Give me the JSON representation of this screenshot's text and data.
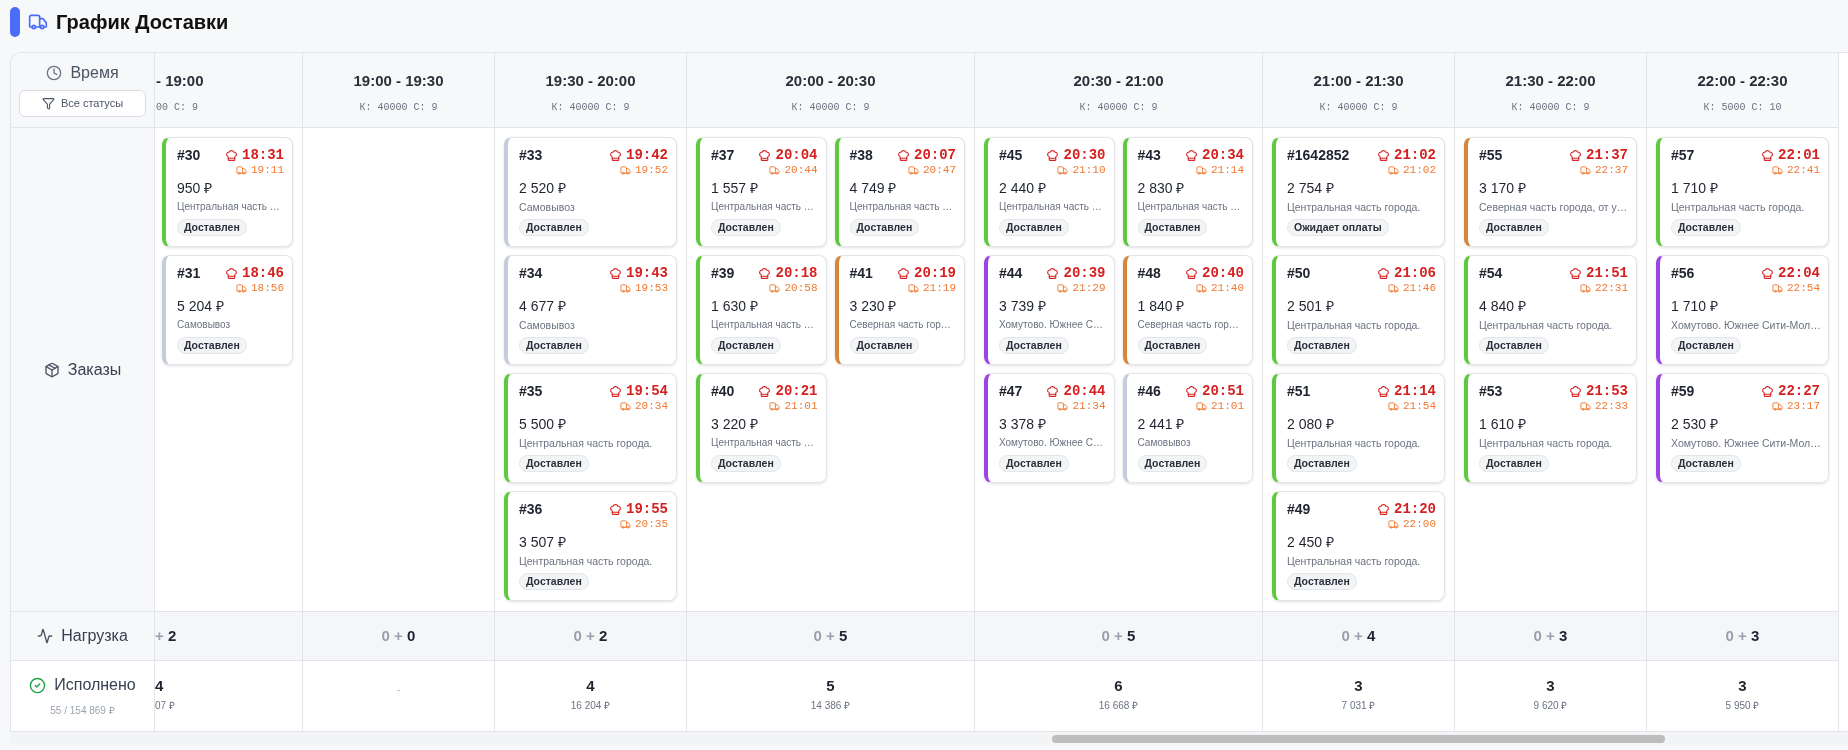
{
  "header": {
    "title": "График Доставки"
  },
  "sidebar": {
    "time_label": "Время",
    "filter_button": "Все статусы",
    "orders_label": "Заказы",
    "load_label": "Нагрузка",
    "done_label": "Исполнено",
    "done_summary": "55 / 154 869 ₽"
  },
  "slots": [
    {
      "time": "- 19:00",
      "capacity": "00 С: 9",
      "clipped": true,
      "load": "+ **2**",
      "done_count": "4",
      "done_sum": "07 ₽",
      "lanes": [
        [
          {
            "number": "#30",
            "ready": "18:31",
            "delivery": "19:11",
            "price": "950 ₽",
            "address": "Центральная часть …",
            "status": "Доставлен",
            "color": "#5ec83e"
          },
          {
            "number": "#31",
            "ready": "18:46",
            "delivery": "18:56",
            "price": "5 204 ₽",
            "address": "Самовывоз",
            "status": "Доставлен",
            "color": "#c5cddd"
          }
        ]
      ]
    },
    {
      "time": "19:00 - 19:30",
      "capacity": "К: 40000 С: 9",
      "clipped": false,
      "load": "0 + **0**",
      "done_count": "-"
    },
    {
      "time": "19:30 - 20:00",
      "capacity": "К: 40000 С: 9",
      "clipped": false,
      "load": "0 + **2**",
      "done_count": "4",
      "done_sum": "16 204 ₽",
      "lanes": [
        [
          {
            "number": "#33",
            "ready": "19:42",
            "delivery": "19:52",
            "price": "2 520 ₽",
            "address": "Самовывоз",
            "status": "Доставлен",
            "color": "#c5cddd"
          },
          {
            "number": "#34",
            "ready": "19:43",
            "delivery": "19:53",
            "price": "4 677 ₽",
            "address": "Самовывоз",
            "status": "Доставлен",
            "color": "#c5cddd"
          },
          {
            "number": "#35",
            "ready": "19:54",
            "delivery": "20:34",
            "price": "5 500 ₽",
            "address": "Центральная часть города.",
            "status": "Доставлен",
            "color": "#5ec83e"
          },
          {
            "number": "#36",
            "ready": "19:55",
            "delivery": "20:35",
            "price": "3 507 ₽",
            "address": "Центральная часть города.",
            "status": "Доставлен",
            "color": "#5ec83e"
          }
        ]
      ]
    },
    {
      "time": "20:00 - 20:30",
      "capacity": "К: 40000 С: 9",
      "clipped": false,
      "load": "0 + **5**",
      "done_count": "5",
      "done_sum": "14 386 ₽",
      "lanes": [
        [
          {
            "number": "#37",
            "ready": "20:04",
            "delivery": "20:44",
            "price": "1 557 ₽",
            "address": "Центральная часть …",
            "status": "Доставлен",
            "color": "#5ec83e"
          },
          {
            "number": "#39",
            "ready": "20:18",
            "delivery": "20:58",
            "price": "1 630 ₽",
            "address": "Центральная часть …",
            "status": "Доставлен",
            "color": "#5ec83e"
          },
          {
            "number": "#40",
            "ready": "20:21",
            "delivery": "21:01",
            "price": "3 220 ₽",
            "address": "Центральная часть …",
            "status": "Доставлен",
            "color": "#5ec83e"
          }
        ],
        [
          {
            "number": "#38",
            "ready": "20:07",
            "delivery": "20:47",
            "price": "4 749 ₽",
            "address": "Центральная часть …",
            "status": "Доставлен",
            "color": "#5ec83e"
          },
          {
            "number": "#41",
            "ready": "20:19",
            "delivery": "21:19",
            "price": "3 230 ₽",
            "address": "Северная часть гор…",
            "status": "Доставлен",
            "color": "#d6853c"
          }
        ]
      ]
    },
    {
      "time": "20:30 - 21:00",
      "capacity": "К: 40000 С: 9",
      "clipped": false,
      "load": "0 + **5**",
      "done_count": "6",
      "done_sum": "16 668 ₽",
      "lanes": [
        [
          {
            "number": "#45",
            "ready": "20:30",
            "delivery": "21:10",
            "price": "2 440 ₽",
            "address": "Центральная часть …",
            "status": "Доставлен",
            "color": "#5ec83e"
          },
          {
            "number": "#44",
            "ready": "20:39",
            "delivery": "21:29",
            "price": "3 739 ₽",
            "address": "Хомутово. Южнее С…",
            "status": "Доставлен",
            "color": "#9b45e4"
          },
          {
            "number": "#47",
            "ready": "20:44",
            "delivery": "21:34",
            "price": "3 378 ₽",
            "address": "Хомутово. Южнее С…",
            "status": "Доставлен",
            "color": "#9b45e4"
          }
        ],
        [
          {
            "number": "#43",
            "ready": "20:34",
            "delivery": "21:14",
            "price": "2 830 ₽",
            "address": "Центральная часть …",
            "status": "Доставлен",
            "color": "#5ec83e"
          },
          {
            "number": "#48",
            "ready": "20:40",
            "delivery": "21:40",
            "price": "1 840 ₽",
            "address": "Северная часть гор…",
            "status": "Доставлен",
            "color": "#d6853c"
          },
          {
            "number": "#46",
            "ready": "20:51",
            "delivery": "21:01",
            "price": "2 441 ₽",
            "address": "Самовывоз",
            "status": "Доставлен",
            "color": "#c5cddd"
          }
        ]
      ]
    },
    {
      "time": "21:00 - 21:30",
      "capacity": "К: 40000 С: 9",
      "clipped": false,
      "load": "0 + **4**",
      "done_count": "3",
      "done_sum": "7 031 ₽",
      "lanes": [
        [
          {
            "number": "#1642852",
            "ready": "21:02",
            "delivery": "21:02",
            "price": "2 754 ₽",
            "address": "Центральная часть города.",
            "status": "Ожидает оплаты",
            "color": "#5ec83e"
          },
          {
            "number": "#50",
            "ready": "21:06",
            "delivery": "21:46",
            "price": "2 501 ₽",
            "address": "Центральная часть города.",
            "status": "Доставлен",
            "color": "#5ec83e"
          },
          {
            "number": "#51",
            "ready": "21:14",
            "delivery": "21:54",
            "price": "2 080 ₽",
            "address": "Центральная часть города.",
            "status": "Доставлен",
            "color": "#5ec83e"
          },
          {
            "number": "#49",
            "ready": "21:20",
            "delivery": "22:00",
            "price": "2 450 ₽",
            "address": "Центральная часть города.",
            "status": "Доставлен",
            "color": "#5ec83e"
          }
        ]
      ]
    },
    {
      "time": "21:30 - 22:00",
      "capacity": "К: 40000 С: 9",
      "clipped": false,
      "load": "0 + **3**",
      "done_count": "3",
      "done_sum": "9 620 ₽",
      "lanes": [
        [
          {
            "number": "#55",
            "ready": "21:37",
            "delivery": "22:37",
            "price": "3 170 ₽",
            "address": "Северная часть города, от у…",
            "status": "Доставлен",
            "color": "#d6853c"
          },
          {
            "number": "#54",
            "ready": "21:51",
            "delivery": "22:31",
            "price": "4 840 ₽",
            "address": "Центральная часть города.",
            "status": "Доставлен",
            "color": "#5ec83e"
          },
          {
            "number": "#53",
            "ready": "21:53",
            "delivery": "22:33",
            "price": "1 610 ₽",
            "address": "Центральная часть города.",
            "status": "Доставлен",
            "color": "#5ec83e"
          }
        ]
      ]
    },
    {
      "time": "22:00 - 22:30",
      "capacity": "К: 5000 С: 10",
      "clipped": false,
      "load": "0 + **3**",
      "done_count": "3",
      "done_sum": "5 950 ₽",
      "lanes": [
        [
          {
            "number": "#57",
            "ready": "22:01",
            "delivery": "22:41",
            "price": "1 710 ₽",
            "address": "Центральная часть города.",
            "status": "Доставлен",
            "color": "#5ec83e"
          },
          {
            "number": "#56",
            "ready": "22:04",
            "delivery": "22:54",
            "price": "1 710 ₽",
            "address": "Хомутово. Южнее Сити-Мол…",
            "status": "Доставлен",
            "color": "#9b45e4"
          },
          {
            "number": "#59",
            "ready": "22:27",
            "delivery": "23:17",
            "price": "2 530 ₽",
            "address": "Хомутово. Южнее Сити-Мол…",
            "status": "Доставлен",
            "color": "#9b45e4"
          }
        ]
      ]
    }
  ]
}
